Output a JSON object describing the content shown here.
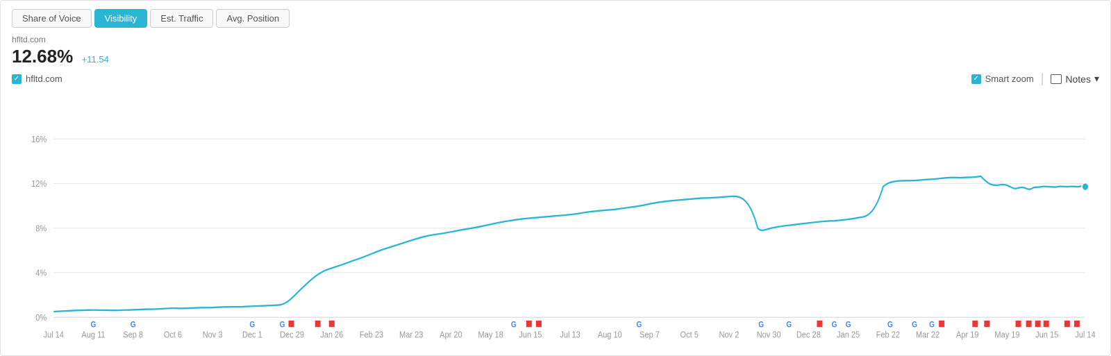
{
  "tabs": [
    {
      "label": "Share of Voice",
      "active": false
    },
    {
      "label": "Visibility",
      "active": true
    },
    {
      "label": "Est. Traffic",
      "active": false
    },
    {
      "label": "Avg. Position",
      "active": false
    }
  ],
  "metric": {
    "domain": "hfltd.com",
    "value": "12.68%",
    "change": "+11.54"
  },
  "legend": {
    "domain": "hfltd.com"
  },
  "controls": {
    "smart_zoom_label": "Smart zoom",
    "notes_label": "Notes"
  },
  "chart": {
    "y_labels": [
      "16%",
      "12%",
      "8%",
      "4%",
      "0%"
    ],
    "x_labels": [
      "Jul 14",
      "Aug 11",
      "Sep 8",
      "Oct 6",
      "Nov 3",
      "Dec 1",
      "Dec 29",
      "Jan 26",
      "Feb 23",
      "Mar 23",
      "Apr 20",
      "May 18",
      "Jun 15",
      "Jul 13",
      "Aug 10",
      "Sep 7",
      "Oct 5",
      "Nov 2",
      "Nov 30",
      "Dec 28",
      "Jan 25",
      "Feb 22",
      "Mar 22",
      "Apr 19",
      "May 19",
      "Jun 15",
      "Jul 14"
    ]
  }
}
